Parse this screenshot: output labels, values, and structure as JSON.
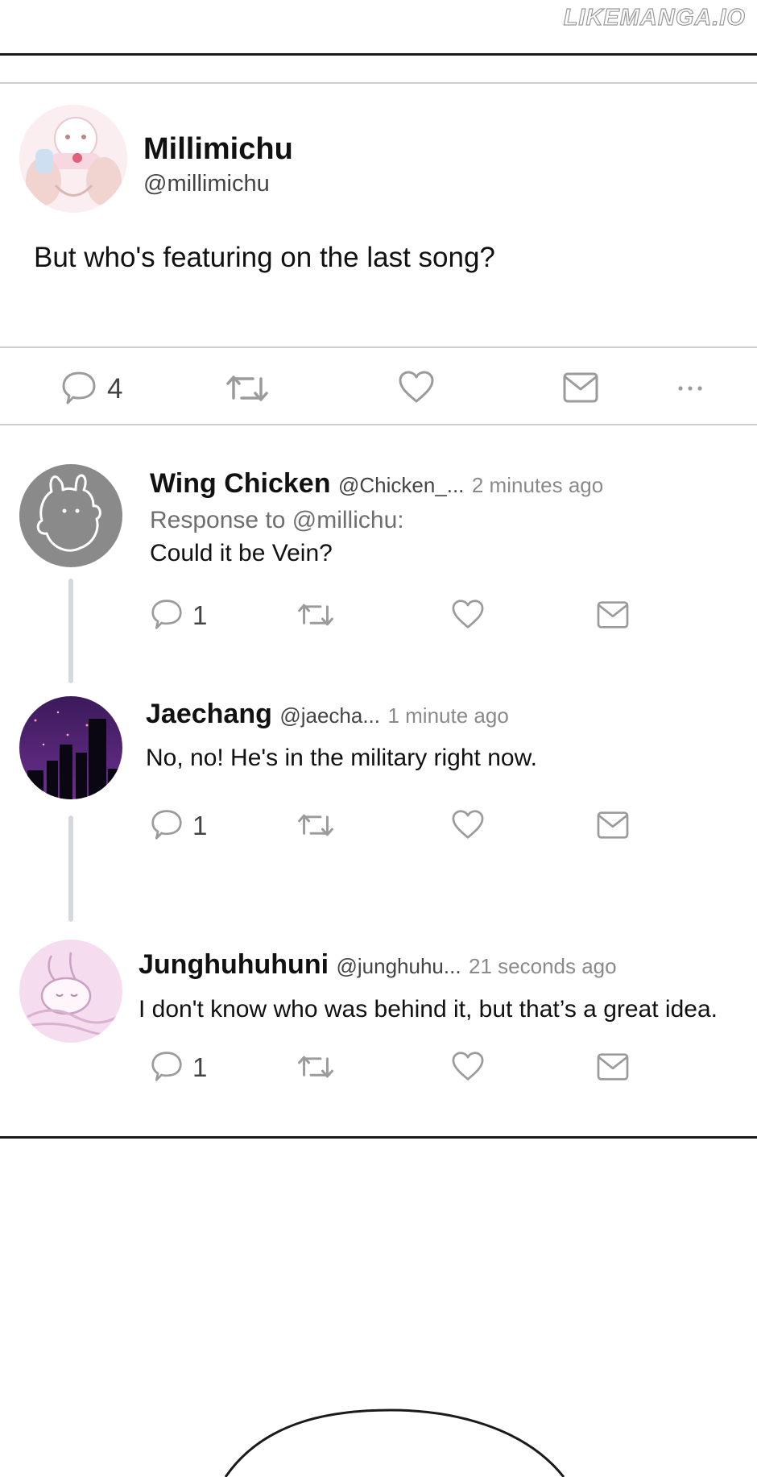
{
  "watermark": "LIKEMANGA.IO",
  "post": {
    "author_name": "Millimichu",
    "author_handle": "@millimichu",
    "text": "But who's featuring on the last song?",
    "reply_count": "4",
    "actions": [
      "reply-icon",
      "retweet-icon",
      "heart-icon",
      "mail-icon",
      "more-icon"
    ]
  },
  "replies": [
    {
      "name": "Wing Chicken",
      "handle": "@Chicken_...",
      "time": "2 minutes ago",
      "response_to": "Response to @millichu:",
      "text": "Could it be Vein?",
      "reply_count": "1"
    },
    {
      "name": "Jaechang",
      "handle": "@jaecha...",
      "time": "1 minute ago",
      "text": "No, no! He's in the military right now.",
      "reply_count": "1"
    },
    {
      "name": "Junghuhuhuni",
      "handle": "@junghuhu...",
      "time": "21 seconds ago",
      "text": "I don't know who was behind it, but that’s a great idea.",
      "reply_count": "1"
    }
  ],
  "colors": {
    "icon": "#9b9b9b",
    "divider": "#cfcfcf",
    "thread_line": "#d6d8df"
  }
}
